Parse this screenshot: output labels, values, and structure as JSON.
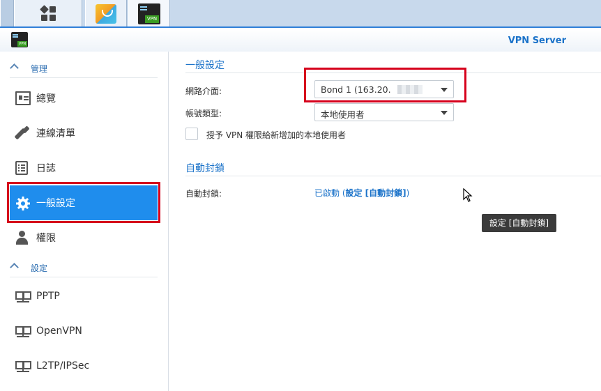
{
  "window": {
    "title": "VPN Server",
    "vpn_badge": "VPN"
  },
  "taskbar": {
    "apps": [
      {
        "name": "main-menu",
        "icon": "grid-icon"
      },
      {
        "name": "package-center",
        "icon": "package-icon"
      },
      {
        "name": "vpn-server",
        "icon": "vpn-server-icon",
        "label": "VPN"
      }
    ]
  },
  "sidebar": {
    "sections": [
      {
        "label": "管理"
      },
      {
        "label": "設定"
      }
    ],
    "items": [
      {
        "label": "總覽",
        "icon": "overview-icon"
      },
      {
        "label": "連線清單",
        "icon": "connection-icon"
      },
      {
        "label": "日誌",
        "icon": "log-icon"
      },
      {
        "label": "一般設定",
        "icon": "gear-icon",
        "active": true
      },
      {
        "label": "權限",
        "icon": "user-icon"
      },
      {
        "label": "PPTP",
        "icon": "network-icon"
      },
      {
        "label": "OpenVPN",
        "icon": "network-icon"
      },
      {
        "label": "L2TP/IPSec",
        "icon": "network-icon"
      }
    ]
  },
  "general": {
    "title": "一般設定",
    "interface_label": "網路介面:",
    "interface_value": "Bond 1 (163.20.",
    "interface_suffix": ")",
    "account_label": "帳號類型:",
    "account_value": "本地使用者",
    "grant_label": "授予 VPN 權限給新增加的本地使用者"
  },
  "autoblock": {
    "title": "自動封鎖",
    "label": "自動封鎖:",
    "status_prefix": "已啟動 (",
    "status_link": "設定 [自動封鎖]",
    "status_suffix": ")"
  },
  "tooltip": {
    "text": "設定 [自動封鎖]"
  },
  "colors": {
    "accent": "#1f8ded",
    "link": "#1a72c9",
    "highlight": "#d6001c"
  }
}
